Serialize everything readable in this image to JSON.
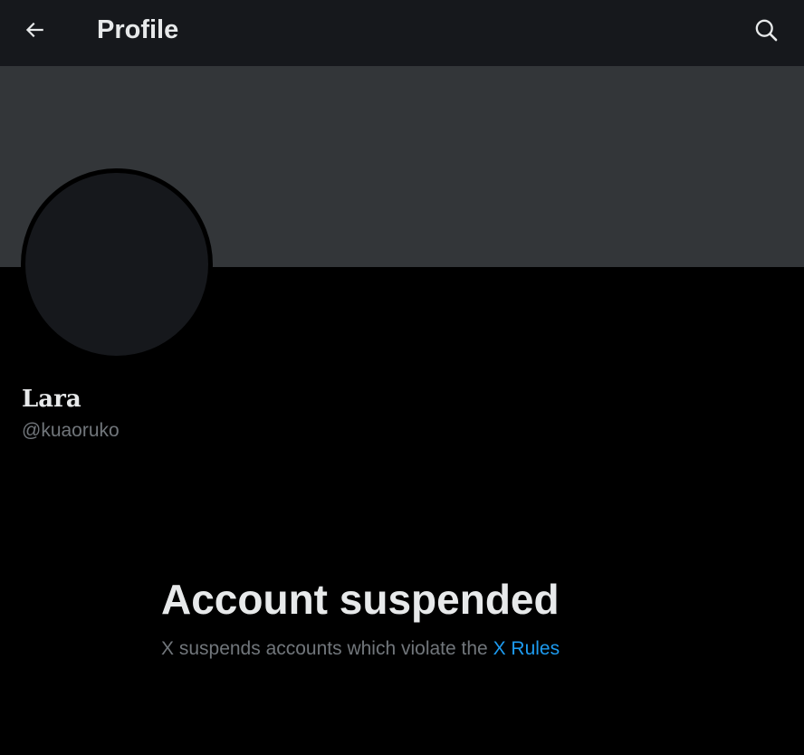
{
  "header": {
    "title": "Profile",
    "back_icon": "arrow-left-icon",
    "search_icon": "search-icon"
  },
  "profile": {
    "display_name": "Lara",
    "handle": "@kuaoruko"
  },
  "suspension": {
    "title": "Account suspended",
    "message": "X suspends accounts which violate the",
    "link_text": "X Rules"
  },
  "colors": {
    "background": "#000000",
    "header_bg": "#16181c",
    "banner_bg": "#333639",
    "avatar_bg": "#16181c",
    "primary_text": "#e7e9ea",
    "secondary_text": "#71767b",
    "link": "#1d9bf0"
  }
}
